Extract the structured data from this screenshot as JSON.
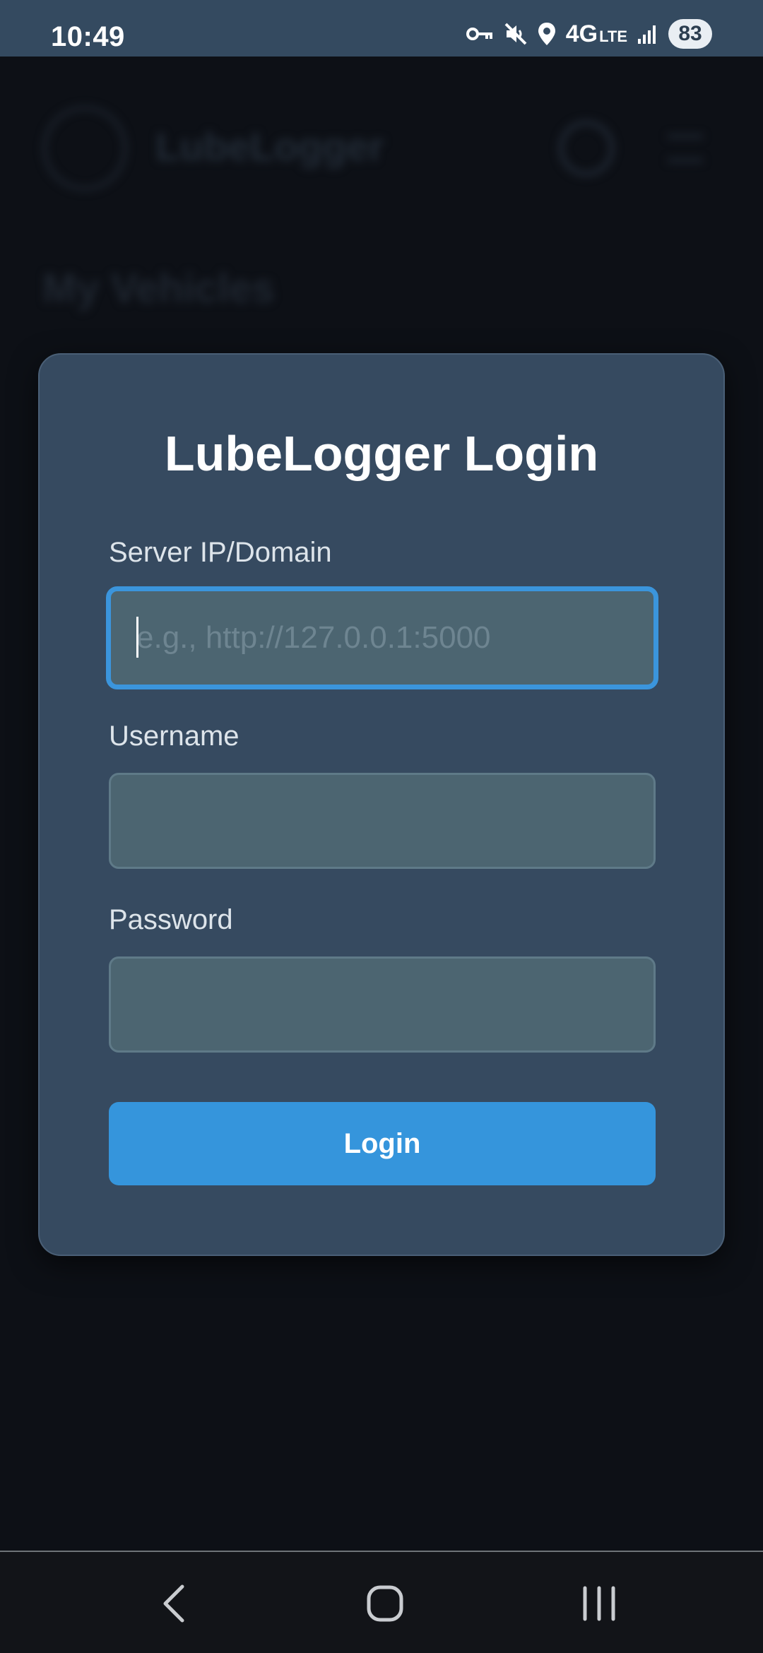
{
  "status_bar": {
    "time": "10:49",
    "network": "4G",
    "network_sub": "LTE",
    "battery": "83",
    "icons": [
      "vpn-key-icon",
      "mute-icon",
      "location-icon",
      "signal-icon"
    ]
  },
  "background_app": {
    "title": "LubeLogger",
    "section_title": "My Vehicles"
  },
  "login_dialog": {
    "title": "LubeLogger Login",
    "server_label": "Server IP/Domain",
    "server_placeholder": "e.g., http://127.0.0.1:5000",
    "server_value": "",
    "username_label": "Username",
    "username_value": "",
    "password_label": "Password",
    "password_value": "",
    "login_button": "Login"
  },
  "nav_bar": {
    "icons": [
      "back-icon",
      "home-icon",
      "recents-icon"
    ]
  },
  "colors": {
    "accent": "#3595dc",
    "dialog_bg": "#364a60",
    "input_bg": "#4c6571",
    "status_bar_bg": "#344a60"
  }
}
